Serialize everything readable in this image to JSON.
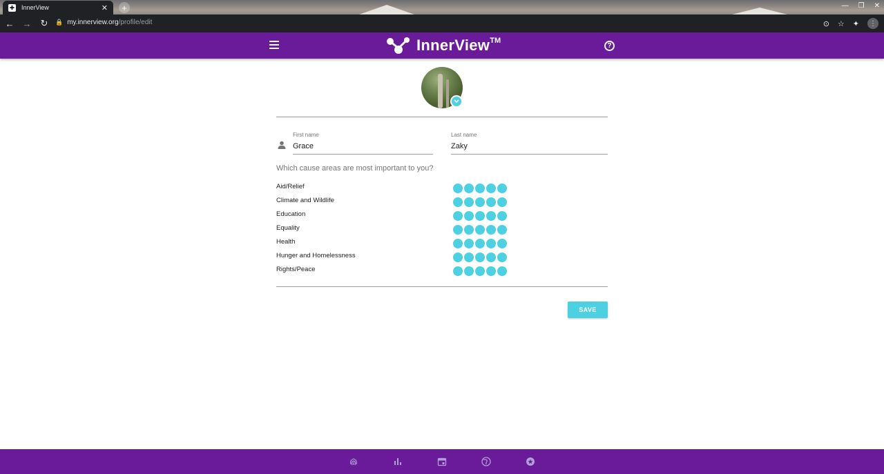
{
  "browser": {
    "tab_title": "InnerView",
    "tab_close": "✕",
    "new_tab": "+",
    "url_host": "my.innerview.org",
    "url_path": "/profile/edit"
  },
  "app": {
    "logo_text": "InnerView",
    "logo_tm": "TM",
    "help_glyph": "?",
    "accent_color": "#6a1b9a",
    "highlight_color": "#4dd0e1"
  },
  "profile": {
    "first_name_label": "First name",
    "first_name_value": "Grace",
    "last_name_label": "Last name",
    "last_name_value": "Zaky"
  },
  "causes": {
    "question": "Which cause areas are most important to you?",
    "items": [
      {
        "label": "Aid/Relief",
        "rating": 5
      },
      {
        "label": "Climate and Wildlife",
        "rating": 5
      },
      {
        "label": "Education",
        "rating": 5
      },
      {
        "label": "Equality",
        "rating": 5
      },
      {
        "label": "Health",
        "rating": 5
      },
      {
        "label": "Hunger and Homelessness",
        "rating": 5
      },
      {
        "label": "Rights/Peace",
        "rating": 5
      }
    ],
    "max_rating": 5
  },
  "actions": {
    "save_label": "SAVE"
  },
  "bottom_nav": [
    {
      "icon": "fingerprint-icon"
    },
    {
      "icon": "bar-chart-icon"
    },
    {
      "icon": "calendar-icon"
    },
    {
      "icon": "globe-icon"
    },
    {
      "icon": "star-badge-icon"
    }
  ]
}
